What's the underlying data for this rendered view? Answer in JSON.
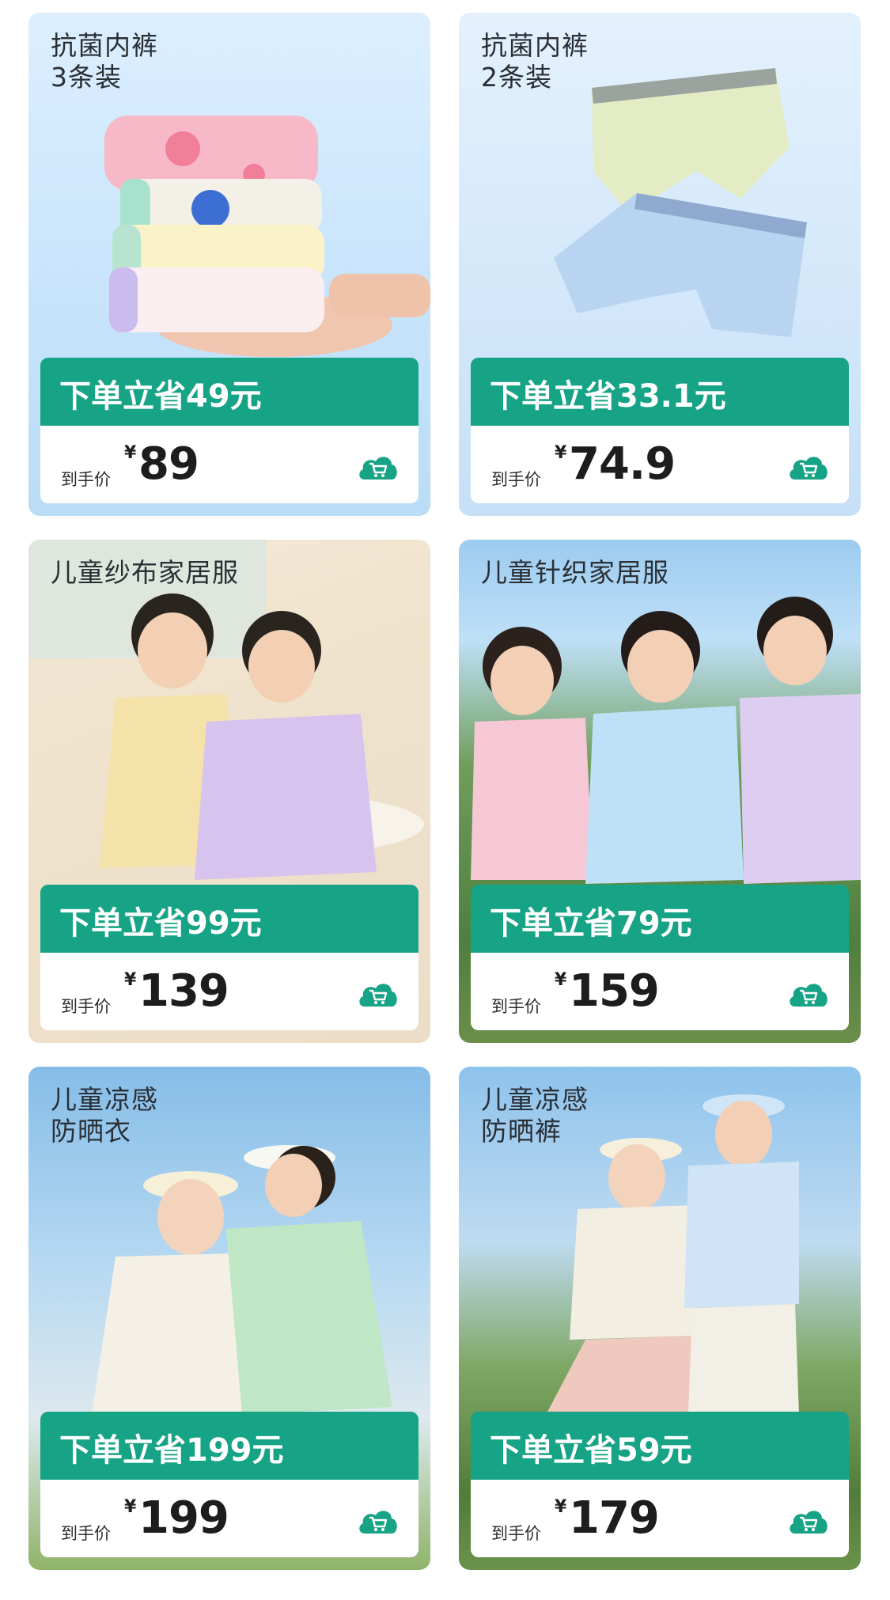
{
  "colors": {
    "accent": "#17a385",
    "promo_text": "#ffffff",
    "price_text": "#1d1d1d",
    "title_text": "#2a2f35"
  },
  "products": [
    {
      "title_lines": [
        "抗菌内裤",
        "3条装"
      ],
      "promo": "下单立省49元",
      "price_label": "到手价",
      "currency": "¥",
      "price": "89",
      "cart_icon": "cart-icon"
    },
    {
      "title_lines": [
        "抗菌内裤",
        "2条装"
      ],
      "promo": "下单立省33.1元",
      "price_label": "到手价",
      "currency": "¥",
      "price": "74.9",
      "cart_icon": "cart-icon"
    },
    {
      "title_lines": [
        "儿童纱布家居服"
      ],
      "promo": "下单立省99元",
      "price_label": "到手价",
      "currency": "¥",
      "price": "139",
      "cart_icon": "cart-icon"
    },
    {
      "title_lines": [
        "儿童针织家居服"
      ],
      "promo": "下单立省79元",
      "price_label": "到手价",
      "currency": "¥",
      "price": "159",
      "cart_icon": "cart-icon"
    },
    {
      "title_lines": [
        "儿童凉感",
        "防晒衣"
      ],
      "promo": "下单立省199元",
      "price_label": "到手价",
      "currency": "¥",
      "price": "199",
      "cart_icon": "cart-icon"
    },
    {
      "title_lines": [
        "儿童凉感",
        "防晒裤"
      ],
      "promo": "下单立省59元",
      "price_label": "到手价",
      "currency": "¥",
      "price": "179",
      "cart_icon": "cart-icon"
    }
  ]
}
